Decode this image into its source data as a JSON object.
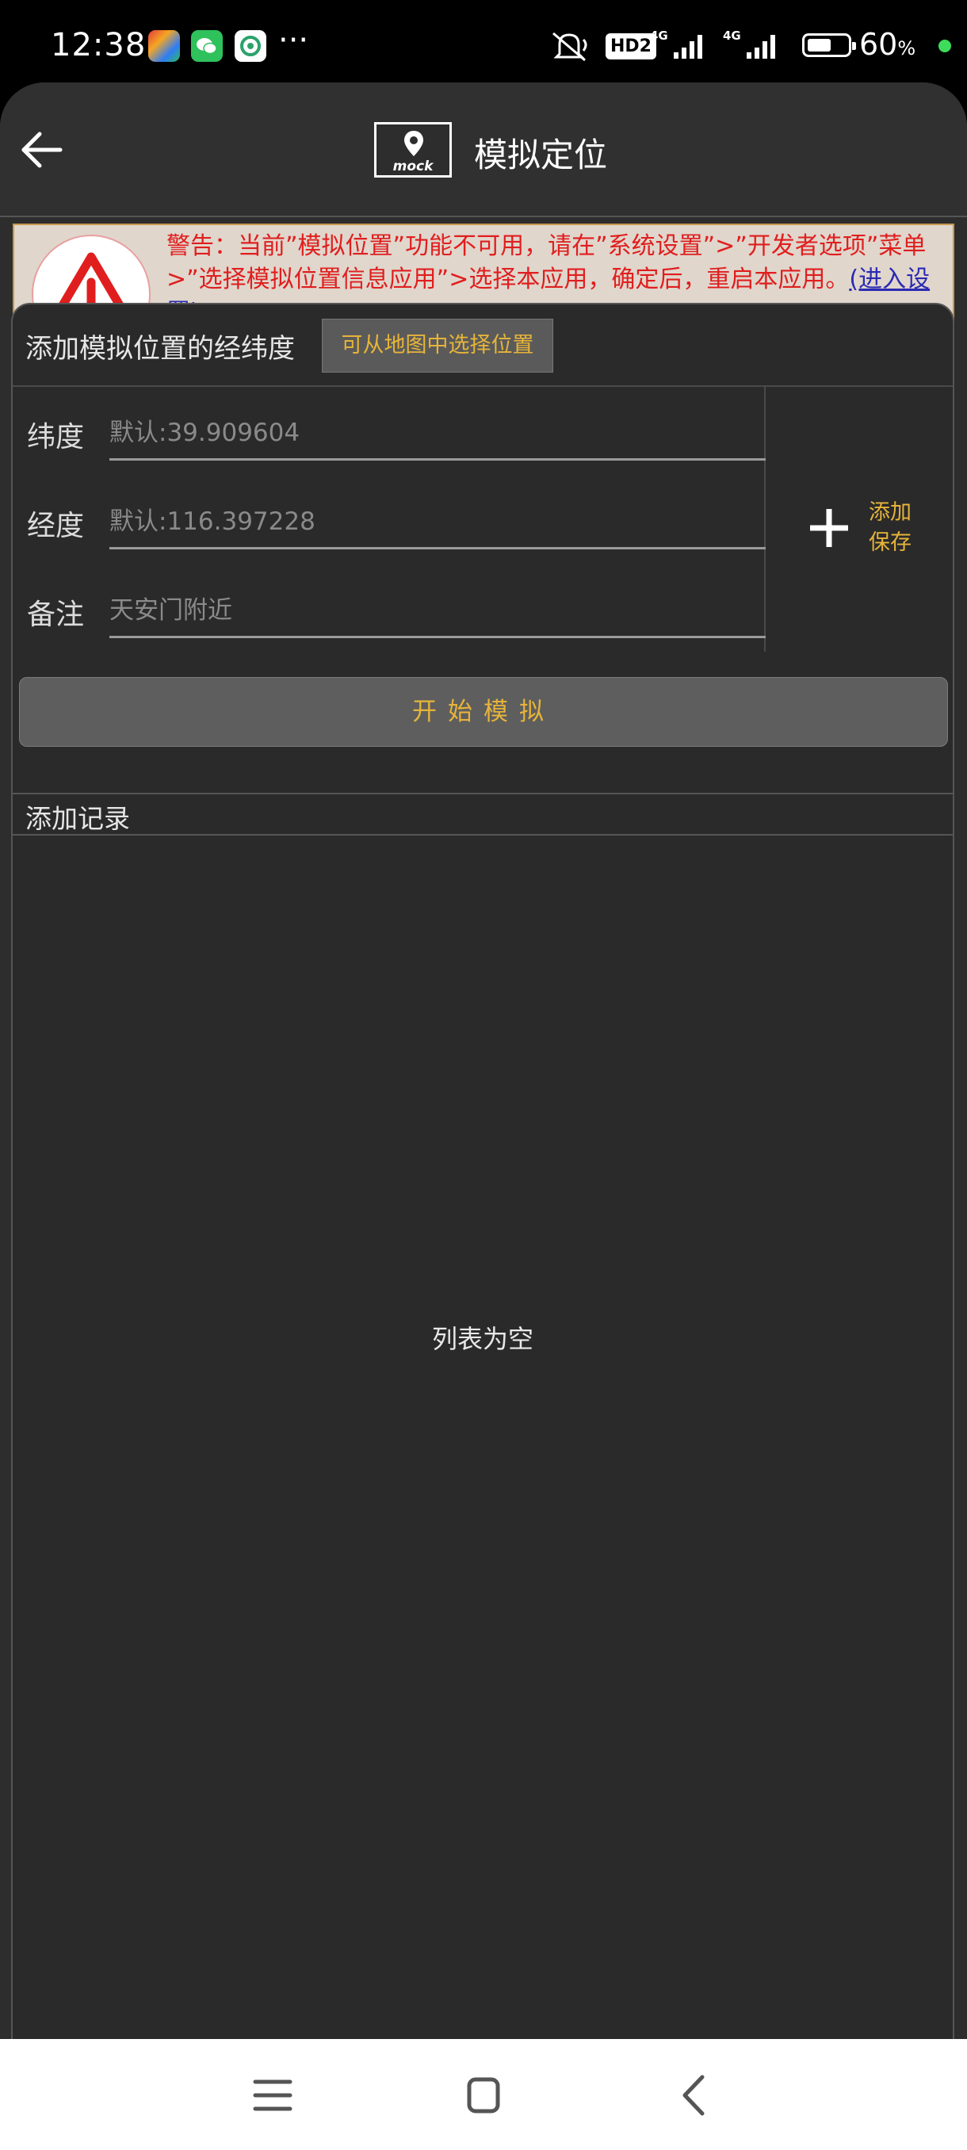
{
  "status_bar": {
    "time": "12:38",
    "more": "···",
    "network_hd": "HD2",
    "net1": "4G",
    "net2": "4G",
    "battery_percent": "60",
    "battery_unit": "%",
    "battery_level": 0.6
  },
  "toolbar": {
    "logo_text": "mock",
    "title": "模拟定位"
  },
  "warning": {
    "text": "警告：当前”模拟位置”功能不可用，请在”系统设置”>”开发者选项”菜单>”选择模拟位置信息应用”>选择本应用，确定后，重启本应用。",
    "link": "(进入设置)"
  },
  "form": {
    "title": "添加模拟位置的经纬度",
    "map_button": "可从地图中选择位置",
    "fields": [
      {
        "label": "纬度",
        "placeholder": "默认:39.909604",
        "value": ""
      },
      {
        "label": "经度",
        "placeholder": "默认:116.397228",
        "value": ""
      },
      {
        "label": "备注",
        "placeholder": "天安门附近",
        "value": ""
      }
    ],
    "add_line1": "添加",
    "add_line2": "保存",
    "start_button": "开始模拟"
  },
  "records": {
    "title": "添加记录",
    "empty": "列表为空"
  },
  "colors": {
    "accent": "#e6b43a",
    "warning_text": "#e01e1e",
    "background": "#2d2d2d"
  },
  "icons": [
    "back-arrow-icon",
    "map-pin-icon",
    "warning-icon",
    "plus-icon",
    "menu-icon",
    "home-icon",
    "back-icon",
    "mute-icon",
    "signal-icon",
    "battery-icon"
  ]
}
